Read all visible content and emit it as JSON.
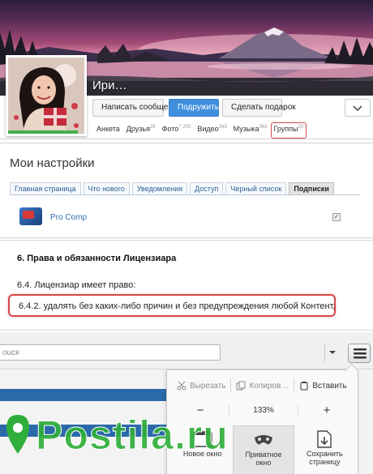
{
  "profile": {
    "name": "Ири…",
    "actions": {
      "message": "Написать сообщение",
      "subscribe": "Подружиться",
      "gift": "Сделать подарок"
    },
    "profile_completion": 0.92,
    "tabs": [
      {
        "label": "Анкета",
        "count": ""
      },
      {
        "label": "Друзья",
        "count": "26"
      },
      {
        "label": "Фото",
        "count": "7 205"
      },
      {
        "label": "Видео",
        "count": "263"
      },
      {
        "label": "Музыка",
        "count": "363"
      },
      {
        "label": "Группы",
        "count": "20"
      }
    ]
  },
  "settings": {
    "title": "Мои настройки",
    "tabs": [
      "Главная страница",
      "Что нового",
      "Уведомления",
      "Доступ",
      "Черный список",
      "Подписки"
    ],
    "active_tab": "Подписки",
    "app_name": "Pro Comp",
    "app_checked": true,
    "check_mark": "✓"
  },
  "license": {
    "section_title": "6. Права и обязанности Лицензиара",
    "subsection": "6.4. Лицензиар имеет право:",
    "highlighted_clause": "6.4.2. удалять без каких-либо причин и без предупреждения любой Контент,"
  },
  "browser": {
    "search_placeholder": "оиск",
    "menu": {
      "cut": "Вырезать",
      "copy": "Копиров…",
      "paste": "Вставить",
      "zoom_minus": "−",
      "zoom_value": "133%",
      "zoom_plus": "+",
      "tiles": [
        {
          "line1": "Новое окно",
          "line2": ""
        },
        {
          "line1": "Приватное",
          "line2": "окно"
        },
        {
          "line1": "Сохранить",
          "line2": "страницу"
        }
      ]
    }
  },
  "watermark": {
    "text": "Postila.ru"
  },
  "colors": {
    "highlight_red": "#d84848",
    "primary_blue": "#3f8fdd",
    "link_blue": "#2b6cb0",
    "bar_blue": "#2b6aaa",
    "watermark_green": "#2fae3b"
  }
}
